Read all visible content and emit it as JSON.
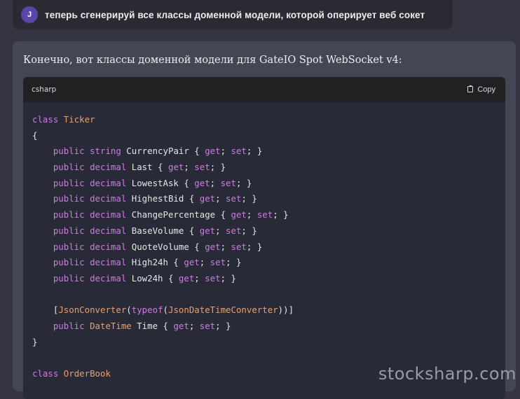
{
  "user_message": {
    "avatar_initial": "J",
    "text": "теперь сгенерируй все классы доменной модели, которой оперирует веб сокет"
  },
  "assistant_message": {
    "intro": "Конечно, вот классы доменной модели для GateIO Spot WebSocket v4:",
    "code_block": {
      "language": "csharp",
      "copy_label": "Copy",
      "lines": [
        [
          [
            "kw",
            "class"
          ],
          [
            "p",
            " "
          ],
          [
            "cls",
            "Ticker"
          ]
        ],
        [
          [
            "p",
            "{"
          ]
        ],
        [
          [
            "p",
            "    "
          ],
          [
            "kw",
            "public"
          ],
          [
            "p",
            " "
          ],
          [
            "kw",
            "string"
          ],
          [
            "p",
            " CurrencyPair { "
          ],
          [
            "kw",
            "get"
          ],
          [
            "p",
            "; "
          ],
          [
            "kw",
            "set"
          ],
          [
            "p",
            "; }"
          ]
        ],
        [
          [
            "p",
            "    "
          ],
          [
            "kw",
            "public"
          ],
          [
            "p",
            " "
          ],
          [
            "kw",
            "decimal"
          ],
          [
            "p",
            " Last { "
          ],
          [
            "kw",
            "get"
          ],
          [
            "p",
            "; "
          ],
          [
            "kw",
            "set"
          ],
          [
            "p",
            "; }"
          ]
        ],
        [
          [
            "p",
            "    "
          ],
          [
            "kw",
            "public"
          ],
          [
            "p",
            " "
          ],
          [
            "kw",
            "decimal"
          ],
          [
            "p",
            " LowestAsk { "
          ],
          [
            "kw",
            "get"
          ],
          [
            "p",
            "; "
          ],
          [
            "kw",
            "set"
          ],
          [
            "p",
            "; }"
          ]
        ],
        [
          [
            "p",
            "    "
          ],
          [
            "kw",
            "public"
          ],
          [
            "p",
            " "
          ],
          [
            "kw",
            "decimal"
          ],
          [
            "p",
            " HighestBid { "
          ],
          [
            "kw",
            "get"
          ],
          [
            "p",
            "; "
          ],
          [
            "kw",
            "set"
          ],
          [
            "p",
            "; }"
          ]
        ],
        [
          [
            "p",
            "    "
          ],
          [
            "kw",
            "public"
          ],
          [
            "p",
            " "
          ],
          [
            "kw",
            "decimal"
          ],
          [
            "p",
            " ChangePercentage { "
          ],
          [
            "kw",
            "get"
          ],
          [
            "p",
            "; "
          ],
          [
            "kw",
            "set"
          ],
          [
            "p",
            "; }"
          ]
        ],
        [
          [
            "p",
            "    "
          ],
          [
            "kw",
            "public"
          ],
          [
            "p",
            " "
          ],
          [
            "kw",
            "decimal"
          ],
          [
            "p",
            " BaseVolume { "
          ],
          [
            "kw",
            "get"
          ],
          [
            "p",
            "; "
          ],
          [
            "kw",
            "set"
          ],
          [
            "p",
            "; }"
          ]
        ],
        [
          [
            "p",
            "    "
          ],
          [
            "kw",
            "public"
          ],
          [
            "p",
            " "
          ],
          [
            "kw",
            "decimal"
          ],
          [
            "p",
            " QuoteVolume { "
          ],
          [
            "kw",
            "get"
          ],
          [
            "p",
            "; "
          ],
          [
            "kw",
            "set"
          ],
          [
            "p",
            "; }"
          ]
        ],
        [
          [
            "p",
            "    "
          ],
          [
            "kw",
            "public"
          ],
          [
            "p",
            " "
          ],
          [
            "kw",
            "decimal"
          ],
          [
            "p",
            " High24h { "
          ],
          [
            "kw",
            "get"
          ],
          [
            "p",
            "; "
          ],
          [
            "kw",
            "set"
          ],
          [
            "p",
            "; }"
          ]
        ],
        [
          [
            "p",
            "    "
          ],
          [
            "kw",
            "public"
          ],
          [
            "p",
            " "
          ],
          [
            "kw",
            "decimal"
          ],
          [
            "p",
            " Low24h { "
          ],
          [
            "kw",
            "get"
          ],
          [
            "p",
            "; "
          ],
          [
            "kw",
            "set"
          ],
          [
            "p",
            "; }"
          ]
        ],
        [],
        [
          [
            "p",
            "    ["
          ],
          [
            "cls",
            "JsonConverter"
          ],
          [
            "p",
            "("
          ],
          [
            "kw",
            "typeof"
          ],
          [
            "p",
            "("
          ],
          [
            "cls",
            "JsonDateTimeConverter"
          ],
          [
            "p",
            "))]"
          ]
        ],
        [
          [
            "p",
            "    "
          ],
          [
            "kw",
            "public"
          ],
          [
            "p",
            " "
          ],
          [
            "cls",
            "DateTime"
          ],
          [
            "p",
            " Time { "
          ],
          [
            "kw",
            "get"
          ],
          [
            "p",
            "; "
          ],
          [
            "kw",
            "set"
          ],
          [
            "p",
            "; }"
          ]
        ],
        [
          [
            "p",
            "}"
          ]
        ],
        [],
        [
          [
            "kw",
            "class"
          ],
          [
            "p",
            " "
          ],
          [
            "cls",
            "OrderBook"
          ]
        ]
      ]
    }
  },
  "watermark": "stocksharp.com",
  "colors": {
    "background": "#343541",
    "user_bubble": "#2a2b32",
    "assistant_bubble": "#444654",
    "code_bg": "#282a37",
    "keyword": "#cc7de0",
    "type_name": "#e5a270",
    "avatar": "#5a46a8"
  }
}
